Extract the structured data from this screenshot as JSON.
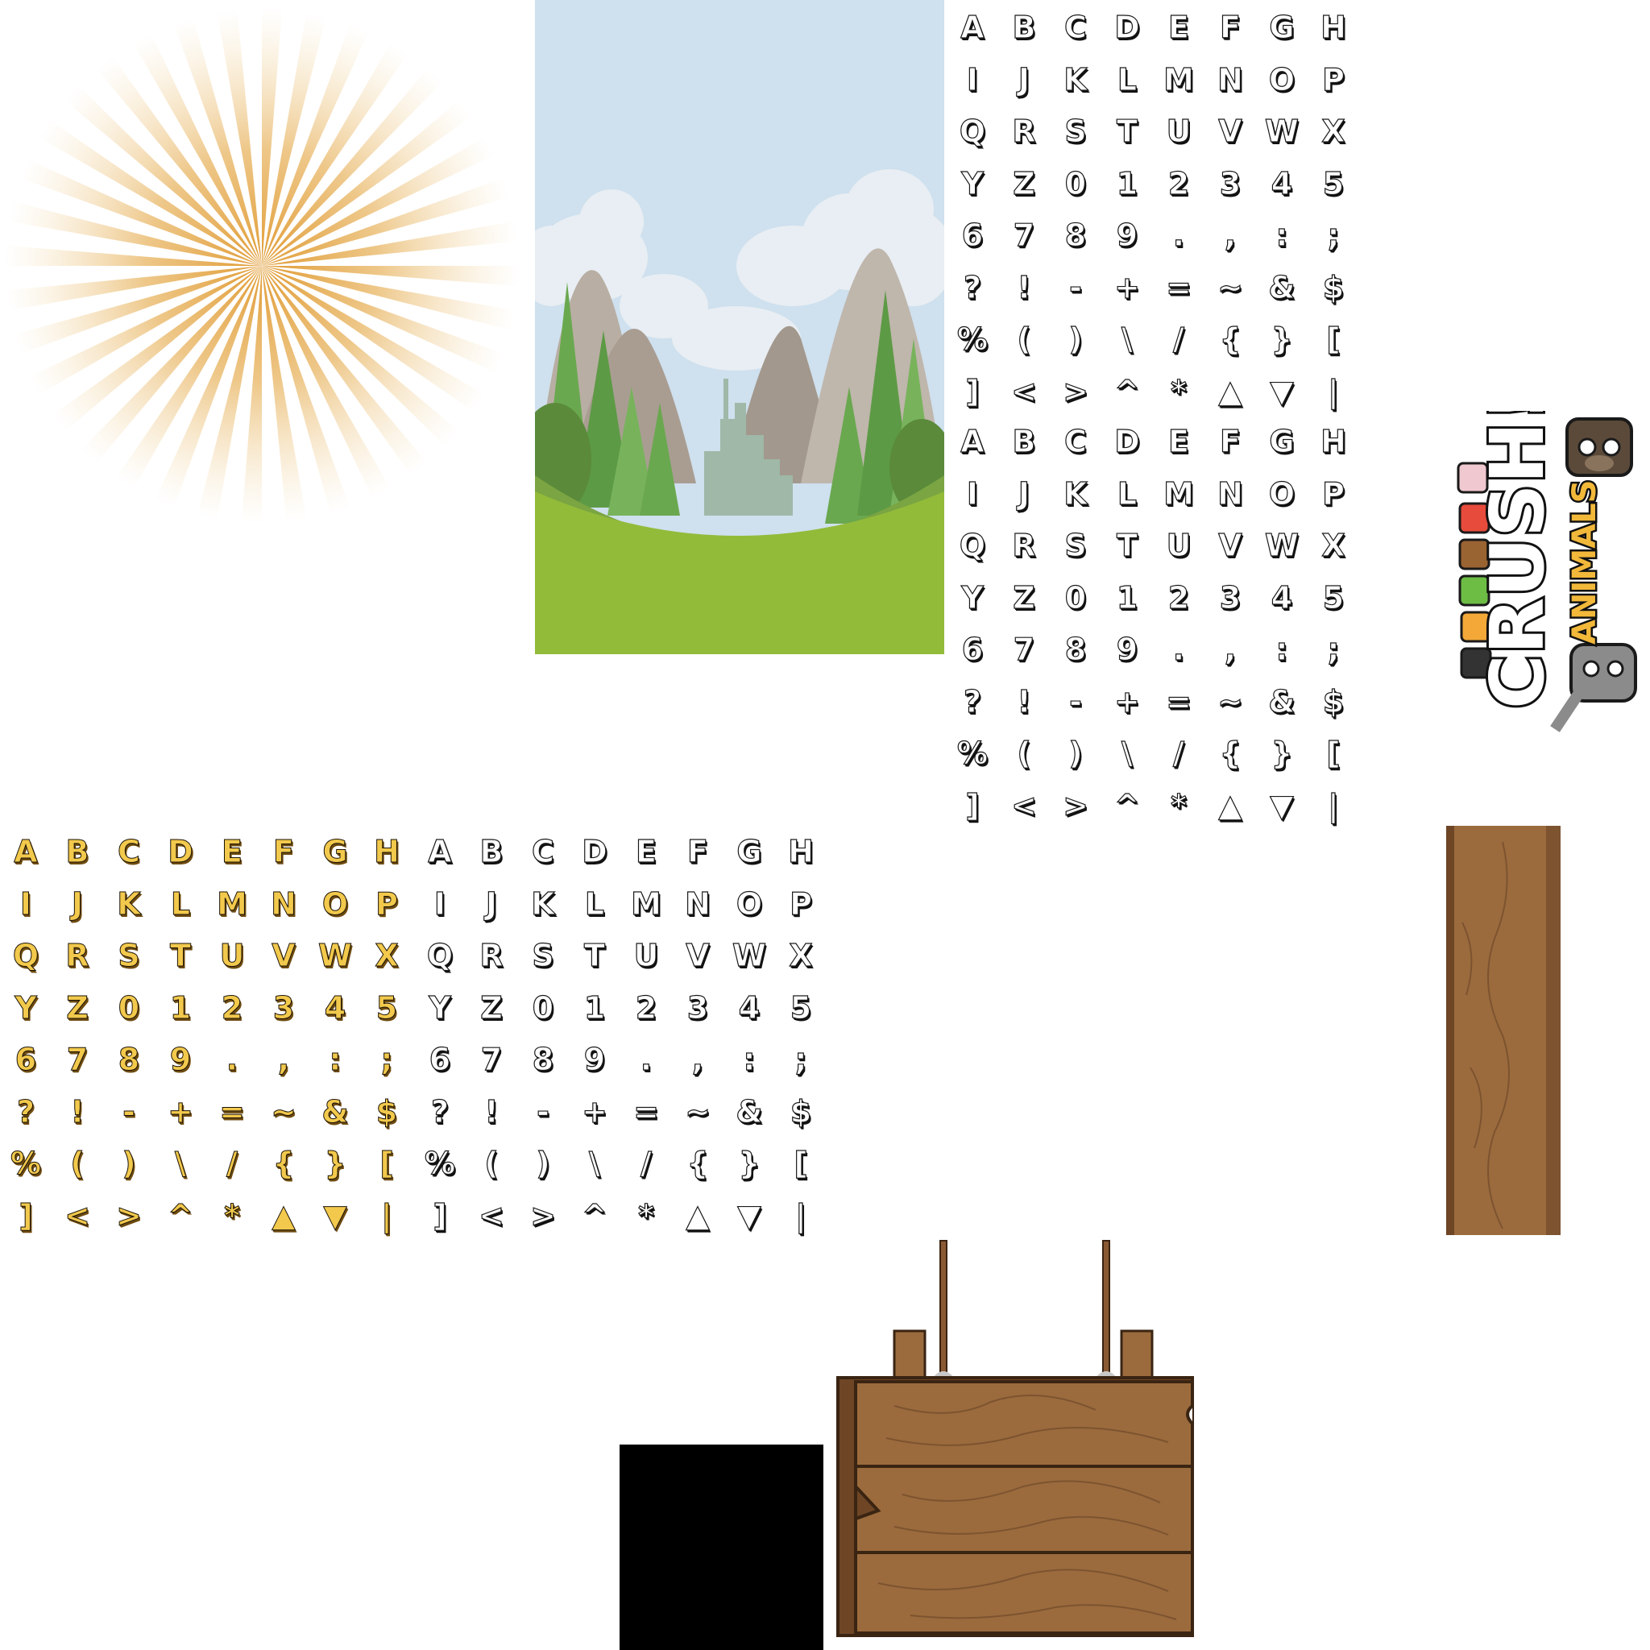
{
  "sheet": {
    "description_colors": {
      "sunburst_ray": "#e3a849",
      "sky": "#cfe0ee",
      "grass": "#93bb3a",
      "mountain": "#b8aea3",
      "tree": "#6aa84f",
      "wood": "#9b6b3d",
      "wood_dark": "#6e4626",
      "gold_glyph": "#f2c94c",
      "logo_yellow": "#f2b83a"
    }
  },
  "font_sets": [
    {
      "id": "white-font-a",
      "style": "white",
      "glyphs": [
        "A",
        "B",
        "C",
        "D",
        "E",
        "F",
        "G",
        "H",
        "I",
        "J",
        "K",
        "L",
        "M",
        "N",
        "O",
        "P",
        "Q",
        "R",
        "S",
        "T",
        "U",
        "V",
        "W",
        "X",
        "Y",
        "Z",
        "0",
        "1",
        "2",
        "3",
        "4",
        "5",
        "6",
        "7",
        "8",
        "9",
        ".",
        ",",
        ":",
        ";",
        "?",
        "!",
        "-",
        "+",
        "=",
        "~",
        "&",
        "$",
        "%",
        "(",
        ")",
        "\\",
        "/",
        "{",
        "}",
        "[",
        "]",
        "<",
        ">",
        "^",
        "*",
        "▲",
        "▼",
        "|"
      ]
    },
    {
      "id": "white-font-b",
      "style": "white",
      "glyphs": [
        "A",
        "B",
        "C",
        "D",
        "E",
        "F",
        "G",
        "H",
        "I",
        "J",
        "K",
        "L",
        "M",
        "N",
        "O",
        "P",
        "Q",
        "R",
        "S",
        "T",
        "U",
        "V",
        "W",
        "X",
        "Y",
        "Z",
        "0",
        "1",
        "2",
        "3",
        "4",
        "5",
        "6",
        "7",
        "8",
        "9",
        ".",
        ",",
        ":",
        ";",
        "?",
        "!",
        "-",
        "+",
        "=",
        "~",
        "&",
        "$",
        "%",
        "(",
        ")",
        "\\",
        "/",
        "{",
        "}",
        "[",
        "]",
        "<",
        ">",
        "^",
        "*",
        "▲",
        "▼",
        "|"
      ]
    },
    {
      "id": "gold-font",
      "style": "gold",
      "glyphs": [
        "A",
        "B",
        "C",
        "D",
        "E",
        "F",
        "G",
        "H",
        "I",
        "J",
        "K",
        "L",
        "M",
        "N",
        "O",
        "P",
        "Q",
        "R",
        "S",
        "T",
        "U",
        "V",
        "W",
        "X",
        "Y",
        "Z",
        "0",
        "1",
        "2",
        "3",
        "4",
        "5",
        "6",
        "7",
        "8",
        "9",
        ".",
        ",",
        ":",
        ";",
        "?",
        "!",
        "-",
        "+",
        "=",
        "~",
        "&",
        "$",
        "%",
        "(",
        ")",
        "\\",
        "/",
        "{",
        "}",
        "[",
        "]",
        "<",
        ">",
        "^",
        "*",
        "▲",
        "▼",
        "|"
      ]
    },
    {
      "id": "white-font-c",
      "style": "white",
      "glyphs": [
        "A",
        "B",
        "C",
        "D",
        "E",
        "F",
        "G",
        "H",
        "I",
        "J",
        "K",
        "L",
        "M",
        "N",
        "O",
        "P",
        "Q",
        "R",
        "S",
        "T",
        "U",
        "V",
        "W",
        "X",
        "Y",
        "Z",
        "0",
        "1",
        "2",
        "3",
        "4",
        "5",
        "6",
        "7",
        "8",
        "9",
        ".",
        ",",
        ":",
        ";",
        "?",
        "!",
        "-",
        "+",
        "=",
        "~",
        "&",
        "$",
        "%",
        "(",
        ")",
        "\\",
        "/",
        "{",
        "}",
        "[",
        "]",
        "<",
        ">",
        "^",
        "*",
        "▲",
        "▼",
        "|"
      ]
    }
  ],
  "logo": {
    "word_top": "ANIMALS",
    "word_bottom": "CRUSH!"
  }
}
